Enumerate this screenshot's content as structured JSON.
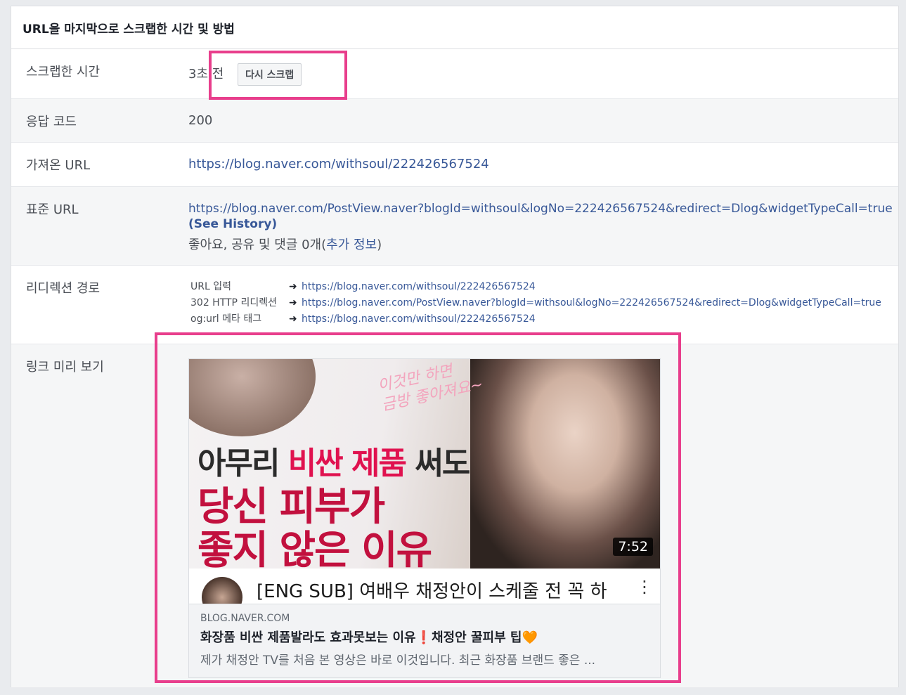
{
  "panel": {
    "title": "URL을 마지막으로 스크랩한 시간 및 방법"
  },
  "rows": {
    "scraped_time": {
      "label": "스크랩한 시간",
      "value": "3초 전",
      "button": "다시 스크랩"
    },
    "response_code": {
      "label": "응답 코드",
      "value": "200"
    },
    "fetched_url": {
      "label": "가져온 URL",
      "value": "https://blog.naver.com/withsoul/222426567524"
    },
    "canonical_url": {
      "label": "표준 URL",
      "value": "https://blog.naver.com/PostView.naver?blogId=withsoul&logNo=222426567524&redirect=Dlog&widgetTypeCall=true",
      "see_history": "(See History)",
      "engagement_prefix": "좋아요, 공유 및 댓글 0개(",
      "engagement_link": "추가 정보",
      "engagement_suffix": ")"
    },
    "redirect_path": {
      "label": "리디렉션 경로",
      "arrow": "➜",
      "items": [
        {
          "source": "URL 입력",
          "url": "https://blog.naver.com/withsoul/222426567524"
        },
        {
          "source": "302 HTTP 리디렉션",
          "url": "https://blog.naver.com/PostView.naver?blogId=withsoul&logNo=222426567524&redirect=Dlog&widgetTypeCall=true"
        },
        {
          "source": "og:url 메타 태그",
          "url": "https://blog.naver.com/withsoul/222426567524"
        }
      ]
    },
    "link_preview": {
      "label": "링크 미리 보기",
      "thumbnail": {
        "script_text_1": "이것만 하면",
        "script_text_2": "금방 좋아져요~",
        "headline_1_a": "아무리 ",
        "headline_1_b": "비싼 제품",
        "headline_1_c": " 써도",
        "headline_2": "당신 피부가",
        "headline_3": "좋지 않은 이유",
        "duration": "7:52",
        "video_title": "[ENG SUB] 여배우 채정안이 스케줄 전 꼭 하",
        "menu_icon": "⋮"
      },
      "domain": "BLOG.NAVER.COM",
      "title": "화장품 비싼 제품발라도 효과못보는 이유❗️채정안 꿀피부 팁🧡",
      "description": "제가 채정안 TV를 처음 본 영상은 바로 이것입니다. 최근 화장품 브랜드 좋은 ..."
    }
  },
  "colors": {
    "highlight": "#e83e8c",
    "link": "#385898",
    "label": "#4b4f56",
    "alt_row": "#f5f6f7"
  }
}
